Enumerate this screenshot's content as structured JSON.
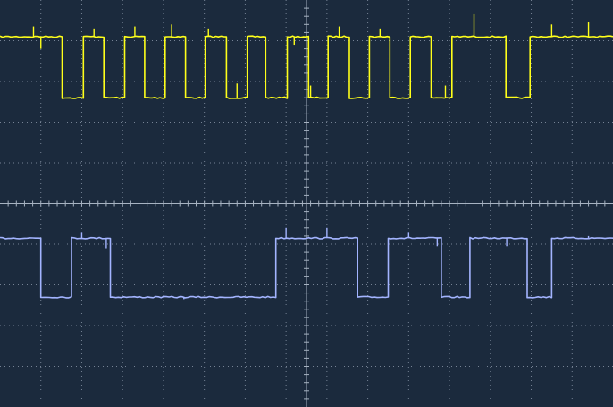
{
  "display": {
    "background": "#1b2a3d",
    "grid_color": "#8d9aab",
    "axis_color": "#a7b3c2",
    "grid_divisions_x": 15,
    "grid_divisions_y": 10,
    "minor_ticks_per_division": 5
  },
  "chart_data": {
    "type": "line",
    "grid": true,
    "xlim": [
      0,
      15
    ],
    "ylim": [
      -5,
      5
    ],
    "series": [
      {
        "color": "#ffff1a",
        "high": 4.1,
        "low": 2.6,
        "initial_level": "high",
        "transitions": [
          1.52,
          2.04,
          2.54,
          3.05,
          3.54,
          4.04,
          4.54,
          5.02,
          5.54,
          6.05,
          6.5,
          7.03,
          7.55,
          8.03,
          8.55,
          9.04,
          9.54,
          10.04,
          10.55,
          11.06,
          12.38,
          12.97
        ],
        "glitches": [
          [
            0.82,
            0.25
          ],
          [
            1.0,
            -0.3
          ],
          [
            2.3,
            0.2
          ],
          [
            3.3,
            0.25
          ],
          [
            4.2,
            0.3
          ],
          [
            5.1,
            0.2
          ],
          [
            5.8,
            0.35
          ],
          [
            7.2,
            -0.2
          ],
          [
            7.6,
            0.3
          ],
          [
            8.3,
            0.25
          ],
          [
            9.3,
            0.2
          ],
          [
            10.9,
            0.3
          ],
          [
            11.6,
            0.55
          ],
          [
            13.5,
            0.3
          ],
          [
            14.4,
            0.35
          ]
        ]
      },
      {
        "color": "#a3b4ff",
        "high": -0.85,
        "low": -2.3,
        "initial_level": "high",
        "transitions": [
          1.0,
          1.75,
          2.7,
          6.75,
          8.75,
          9.5,
          10.8,
          11.5,
          12.9,
          13.5
        ],
        "glitches": [
          [
            2.0,
            0.15
          ],
          [
            2.6,
            -0.25
          ],
          [
            4.5,
            -0.05
          ],
          [
            7.0,
            0.25
          ],
          [
            8.0,
            0.25
          ],
          [
            10.0,
            0.15
          ],
          [
            10.7,
            -0.2
          ],
          [
            12.4,
            -0.2
          ],
          [
            14.4,
            0.05
          ]
        ]
      }
    ]
  }
}
